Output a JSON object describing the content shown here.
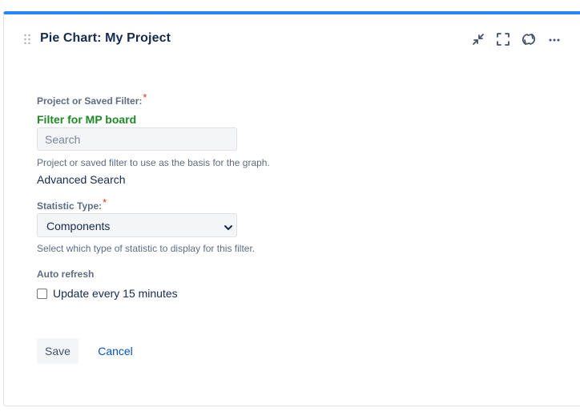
{
  "gadget": {
    "title": "Pie Chart: My Project",
    "accent_color": "#2684ff",
    "header_icons": [
      "minimize-icon",
      "fullscreen-icon",
      "refresh-icon",
      "more-icon"
    ]
  },
  "form": {
    "project_filter": {
      "label": "Project or Saved Filter:",
      "required_marker": "*",
      "selected_value": "Filter for MP board",
      "search_placeholder": "Search",
      "help_text": "Project or saved filter to use as the basis for the graph.",
      "advanced_search_label": "Advanced Search"
    },
    "statistic_type": {
      "label": "Statistic Type:",
      "required_marker": "*",
      "selected_option": "Components",
      "help_text": "Select which type of statistic to display for this filter."
    },
    "auto_refresh": {
      "label": "Auto refresh",
      "checkbox_label": "Update every 15 minutes",
      "checked": false
    },
    "buttons": {
      "save_label": "Save",
      "cancel_label": "Cancel"
    }
  },
  "colors": {
    "selected_filter": "#1f8a24",
    "required": "#de350b",
    "link": "#0052cc"
  }
}
